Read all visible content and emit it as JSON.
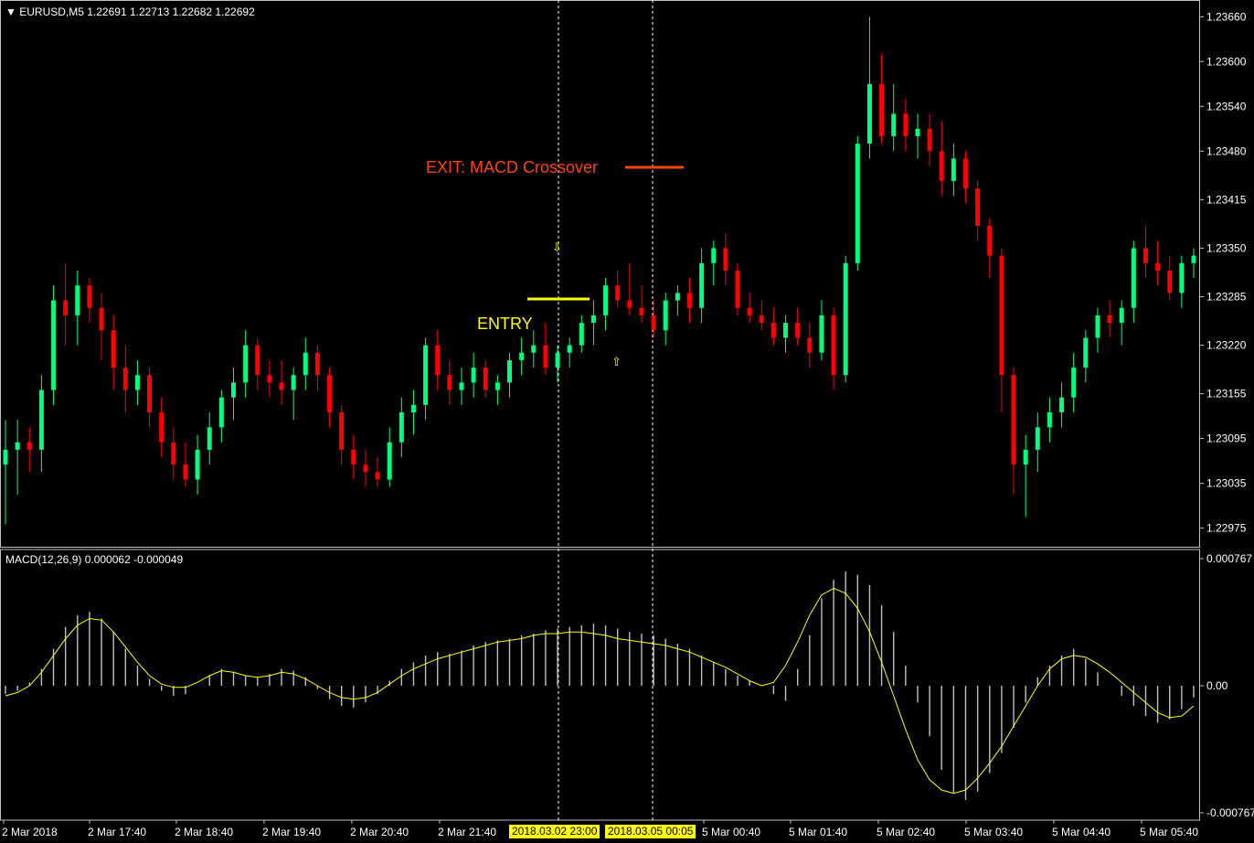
{
  "header": {
    "symbol_line": "EURUSD,M5  1.22691 1.22713 1.22682 1.22692"
  },
  "indicator": {
    "label": "MACD(12,26,9) 0.000062 -0.000049"
  },
  "annotations": {
    "entry_label": "ENTRY",
    "exit_label": "EXIT: MACD Crossover"
  },
  "crosshair": {
    "badge_1": "2018.03.02 23:00",
    "badge_2": "2018.03.05 00:05"
  },
  "colors": {
    "bull": "#00ff7f",
    "bear": "#ff0000",
    "entry": "#ffff00",
    "exit": "#ff4500",
    "signal_line": "#ffff00",
    "histogram": "#c0c0c0"
  },
  "chart_data": {
    "type": "candlestick",
    "price_axis": {
      "ticks": [
        "1.23660",
        "1.23600",
        "1.23540",
        "1.23480",
        "1.23415",
        "1.23350",
        "1.23285",
        "1.23220",
        "1.23155",
        "1.23095",
        "1.23035",
        "1.22975"
      ],
      "range": [
        1.2295,
        1.2368
      ]
    },
    "macd_axis": {
      "ticks": [
        "0.000767",
        "0.00",
        "-0.000767"
      ],
      "range": [
        -0.000767,
        0.000767
      ]
    },
    "time_labels": [
      "2 Mar 2018",
      "2 Mar 17:40",
      "2 Mar 18:40",
      "2 Mar 19:40",
      "2 Mar 20:40",
      "2 Mar 21:40",
      "5 Mar 00:40",
      "5 Mar 01:40",
      "5 Mar 02:40",
      "5 Mar 03:40",
      "5 Mar 04:40",
      "5 Mar 05:40"
    ],
    "candles": [
      [
        1.2306,
        1.2312,
        1.2298,
        1.2308
      ],
      [
        1.2308,
        1.2312,
        1.2302,
        1.2309
      ],
      [
        1.2309,
        1.2311,
        1.2305,
        1.2308
      ],
      [
        1.2308,
        1.2318,
        1.2305,
        1.2316
      ],
      [
        1.2316,
        1.233,
        1.2314,
        1.2328
      ],
      [
        1.2328,
        1.2333,
        1.2322,
        1.2326
      ],
      [
        1.2326,
        1.2332,
        1.2322,
        1.233
      ],
      [
        1.233,
        1.2331,
        1.2325,
        1.2327
      ],
      [
        1.2327,
        1.2329,
        1.232,
        1.2324
      ],
      [
        1.2324,
        1.2326,
        1.2316,
        1.2319
      ],
      [
        1.2319,
        1.2322,
        1.2313,
        1.2316
      ],
      [
        1.2316,
        1.232,
        1.2314,
        1.2318
      ],
      [
        1.2318,
        1.2319,
        1.2311,
        1.2313
      ],
      [
        1.2313,
        1.2315,
        1.2307,
        1.2309
      ],
      [
        1.2309,
        1.2311,
        1.2304,
        1.2306
      ],
      [
        1.2306,
        1.2309,
        1.2303,
        1.2304
      ],
      [
        1.2304,
        1.231,
        1.2302,
        1.2308
      ],
      [
        1.2308,
        1.2313,
        1.2306,
        1.2311
      ],
      [
        1.2311,
        1.2316,
        1.2309,
        1.2315
      ],
      [
        1.2315,
        1.2319,
        1.2312,
        1.2317
      ],
      [
        1.2317,
        1.2324,
        1.2315,
        1.2322
      ],
      [
        1.2322,
        1.2323,
        1.2316,
        1.2318
      ],
      [
        1.2318,
        1.232,
        1.2315,
        1.2317
      ],
      [
        1.2317,
        1.232,
        1.2314,
        1.2316
      ],
      [
        1.2316,
        1.2319,
        1.2312,
        1.2318
      ],
      [
        1.2318,
        1.2323,
        1.2316,
        1.2321
      ],
      [
        1.2321,
        1.2322,
        1.2316,
        1.2318
      ],
      [
        1.2318,
        1.2319,
        1.2311,
        1.2313
      ],
      [
        1.2313,
        1.2314,
        1.2306,
        1.2308
      ],
      [
        1.2308,
        1.231,
        1.2304,
        1.2306
      ],
      [
        1.2306,
        1.2308,
        1.2303,
        1.2305
      ],
      [
        1.2305,
        1.2307,
        1.2303,
        1.2304
      ],
      [
        1.2304,
        1.2311,
        1.2303,
        1.2309
      ],
      [
        1.2309,
        1.2315,
        1.2307,
        1.2313
      ],
      [
        1.2313,
        1.2316,
        1.231,
        1.2314
      ],
      [
        1.2314,
        1.2323,
        1.2312,
        1.2322
      ],
      [
        1.2322,
        1.2324,
        1.2316,
        1.2318
      ],
      [
        1.2318,
        1.232,
        1.2314,
        1.2316
      ],
      [
        1.2316,
        1.2319,
        1.2314,
        1.2317
      ],
      [
        1.2317,
        1.2321,
        1.2315,
        1.2319
      ],
      [
        1.2319,
        1.232,
        1.2315,
        1.2316
      ],
      [
        1.2316,
        1.2318,
        1.2314,
        1.2317
      ],
      [
        1.2317,
        1.2321,
        1.2315,
        1.232
      ],
      [
        1.232,
        1.2323,
        1.2318,
        1.2321
      ],
      [
        1.2321,
        1.2324,
        1.2319,
        1.2322
      ],
      [
        1.2322,
        1.2325,
        1.2318,
        1.2319
      ],
      [
        1.2319,
        1.2322,
        1.2317,
        1.2321
      ],
      [
        1.2321,
        1.2323,
        1.2319,
        1.2322
      ],
      [
        1.2322,
        1.2326,
        1.2321,
        1.2325
      ],
      [
        1.2325,
        1.2328,
        1.2322,
        1.2326
      ],
      [
        1.2326,
        1.2331,
        1.2324,
        1.233
      ],
      [
        1.233,
        1.2332,
        1.2327,
        1.2328
      ],
      [
        1.2328,
        1.2333,
        1.2326,
        1.2327
      ],
      [
        1.2327,
        1.233,
        1.2325,
        1.2326
      ],
      [
        1.2326,
        1.2328,
        1.2323,
        1.2324
      ],
      [
        1.2324,
        1.2329,
        1.2322,
        1.2328
      ],
      [
        1.2328,
        1.233,
        1.2326,
        1.2329
      ],
      [
        1.2329,
        1.2331,
        1.2325,
        1.2327
      ],
      [
        1.2327,
        1.2335,
        1.2325,
        1.2333
      ],
      [
        1.2333,
        1.2336,
        1.233,
        1.2335
      ],
      [
        1.2335,
        1.2337,
        1.233,
        1.2332
      ],
      [
        1.2332,
        1.2333,
        1.2326,
        1.2327
      ],
      [
        1.2327,
        1.2329,
        1.2325,
        1.2326
      ],
      [
        1.2326,
        1.2328,
        1.2324,
        1.2325
      ],
      [
        1.2325,
        1.2327,
        1.2322,
        1.2323
      ],
      [
        1.2323,
        1.2326,
        1.2321,
        1.2325
      ],
      [
        1.2325,
        1.2327,
        1.2322,
        1.2323
      ],
      [
        1.2323,
        1.2325,
        1.2319,
        1.2321
      ],
      [
        1.2321,
        1.2328,
        1.232,
        1.2326
      ],
      [
        1.2326,
        1.2327,
        1.2316,
        1.2318
      ],
      [
        1.2318,
        1.2334,
        1.2317,
        1.2333
      ],
      [
        1.2333,
        1.235,
        1.2332,
        1.2349
      ],
      [
        1.2349,
        1.2366,
        1.2347,
        1.2357
      ],
      [
        1.2357,
        1.2361,
        1.2349,
        1.235
      ],
      [
        1.235,
        1.2357,
        1.2348,
        1.2353
      ],
      [
        1.2353,
        1.2355,
        1.2348,
        1.235
      ],
      [
        1.235,
        1.2353,
        1.2347,
        1.2351
      ],
      [
        1.2351,
        1.2353,
        1.2346,
        1.2348
      ],
      [
        1.2348,
        1.2352,
        1.2342,
        1.2344
      ],
      [
        1.2344,
        1.2349,
        1.2342,
        1.2347
      ],
      [
        1.2347,
        1.2348,
        1.2341,
        1.2343
      ],
      [
        1.2343,
        1.2344,
        1.2336,
        1.2338
      ],
      [
        1.2338,
        1.2339,
        1.2331,
        1.2334
      ],
      [
        1.2334,
        1.2335,
        1.2313,
        1.2318
      ],
      [
        1.2318,
        1.2319,
        1.2302,
        1.2306
      ],
      [
        1.2306,
        1.231,
        1.2299,
        1.2308
      ],
      [
        1.2308,
        1.2313,
        1.2305,
        1.2311
      ],
      [
        1.2311,
        1.2315,
        1.2309,
        1.2313
      ],
      [
        1.2313,
        1.2317,
        1.2311,
        1.2315
      ],
      [
        1.2315,
        1.2321,
        1.2313,
        1.2319
      ],
      [
        1.2319,
        1.2324,
        1.2317,
        1.2323
      ],
      [
        1.2323,
        1.2327,
        1.2321,
        1.2326
      ],
      [
        1.2326,
        1.2328,
        1.2323,
        1.2325
      ],
      [
        1.2325,
        1.2328,
        1.2322,
        1.2327
      ],
      [
        1.2327,
        1.2336,
        1.2325,
        1.2335
      ],
      [
        1.2335,
        1.2338,
        1.2331,
        1.2333
      ],
      [
        1.2333,
        1.2336,
        1.233,
        1.2332
      ],
      [
        1.2332,
        1.2334,
        1.2328,
        1.2329
      ],
      [
        1.2329,
        1.2334,
        1.2327,
        1.2333
      ],
      [
        1.2333,
        1.2335,
        1.2331,
        1.2334
      ]
    ],
    "macd_hist": [
      -5e-05,
      -3e-05,
      2e-05,
      0.0001,
      0.00022,
      0.00035,
      0.00042,
      0.00044,
      0.0004,
      0.00032,
      0.00022,
      0.00012,
      4e-05,
      -3e-05,
      -6e-05,
      -5e-05,
      0,
      6e-05,
      0.0001,
      8e-05,
      6e-05,
      5e-05,
      7e-05,
      0.0001,
      9e-05,
      5e-05,
      -2e-05,
      -8e-05,
      -0.00012,
      -0.00013,
      -0.0001,
      -5e-05,
      3e-05,
      0.0001,
      0.00014,
      0.00018,
      0.0002,
      0.00019,
      0.00021,
      0.00024,
      0.00026,
      0.00027,
      0.00028,
      0.0003,
      0.00031,
      0.00033,
      0.00034,
      0.00035,
      0.00036,
      0.00037,
      0.00036,
      0.00034,
      0.00032,
      0.00031,
      0.0003,
      0.00028,
      0.00025,
      0.00022,
      0.00018,
      0.00014,
      0.0001,
      6e-05,
      3e-05,
      0,
      -5e-05,
      -9e-05,
      0.0001,
      0.0003,
      0.00052,
      0.00063,
      0.00068,
      0.00066,
      0.0006,
      0.00048,
      0.00032,
      0.00012,
      -0.0001,
      -0.0003,
      -0.0005,
      -0.00064,
      -0.00068,
      -0.00063,
      -0.00052,
      -0.0004,
      -0.00025,
      -0.0001,
      5e-05,
      0.00012,
      0.00018,
      0.00022,
      0.00016,
      8e-05,
      0,
      -6e-05,
      -0.00012,
      -0.00018,
      -0.00022,
      -0.0002,
      -0.00014,
      -7e-05
    ],
    "macd_signal": [
      -6e-05,
      -4e-05,
      0,
      8e-05,
      0.00018,
      0.00028,
      0.00036,
      0.0004,
      0.00039,
      0.00032,
      0.00023,
      0.00014,
      6e-05,
      1e-05,
      -1e-05,
      -1e-05,
      2e-05,
      6e-05,
      9e-05,
      8e-05,
      6e-05,
      5e-05,
      6e-05,
      8e-05,
      7e-05,
      4e-05,
      0,
      -4e-05,
      -7e-05,
      -8e-05,
      -7e-05,
      -4e-05,
      1e-05,
      6e-05,
      0.0001,
      0.00013,
      0.00016,
      0.00018,
      0.0002,
      0.00022,
      0.00024,
      0.00026,
      0.00027,
      0.00028,
      0.0003,
      0.00031,
      0.00031,
      0.00032,
      0.00032,
      0.00031,
      0.0003,
      0.00028,
      0.00027,
      0.00026,
      0.00025,
      0.00024,
      0.00022,
      0.0002,
      0.00017,
      0.00014,
      0.00011,
      7e-05,
      3e-05,
      0,
      2e-05,
      0.00012,
      0.00026,
      0.00042,
      0.00054,
      0.00058,
      0.00055,
      0.00046,
      0.00032,
      0.00014,
      -6e-05,
      -0.00026,
      -0.00044,
      -0.00056,
      -0.00062,
      -0.00064,
      -0.00062,
      -0.00055,
      -0.00046,
      -0.00036,
      -0.00024,
      -0.00012,
      0,
      0.0001,
      0.00016,
      0.00018,
      0.00017,
      0.00013,
      8e-05,
      2e-05,
      -4e-05,
      -0.0001,
      -0.00016,
      -0.00019,
      -0.00018,
      -0.00012
    ]
  }
}
